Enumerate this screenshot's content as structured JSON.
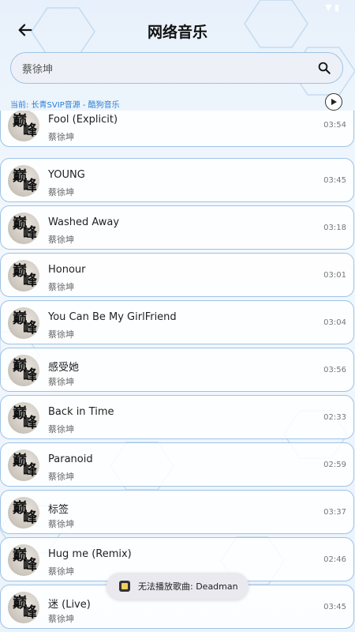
{
  "header": {
    "title": "网络音乐",
    "back_icon": "arrow-left-icon"
  },
  "search": {
    "value": "蔡徐坤",
    "icon": "search-icon"
  },
  "source": {
    "label": "当前: 长青SVIP音源 - 酷狗音乐",
    "play_icon": "play-circle-icon"
  },
  "colors": {
    "accent": "#2b7fd4",
    "card_border": "#9ec3e6",
    "search_bg": "#eef0f7"
  },
  "songs": [
    {
      "title": "Fool (Explicit)",
      "artist": "蔡徐坤",
      "duration": "03:54"
    },
    {
      "title": "YOUNG",
      "artist": "蔡徐坤",
      "duration": "03:45"
    },
    {
      "title": "Washed Away",
      "artist": "蔡徐坤",
      "duration": "03:18"
    },
    {
      "title": "Honour",
      "artist": "蔡徐坤",
      "duration": "03:01"
    },
    {
      "title": "You Can Be My GirlFriend",
      "artist": "蔡徐坤",
      "duration": "03:04"
    },
    {
      "title": "感受她",
      "artist": "蔡徐坤",
      "duration": "03:56"
    },
    {
      "title": "Back in Time",
      "artist": "蔡徐坤",
      "duration": "02:33"
    },
    {
      "title": "Paranoid",
      "artist": "蔡徐坤",
      "duration": "02:59"
    },
    {
      "title": "标签",
      "artist": "蔡徐坤",
      "duration": "03:37"
    },
    {
      "title": "Hug me (Remix)",
      "artist": "蔡徐坤",
      "duration": "02:46"
    },
    {
      "title": "迷 (Live)",
      "artist": "蔡徐坤",
      "duration": "03:45"
    }
  ],
  "toast": {
    "text": "无法播放歌曲: Deadman"
  }
}
